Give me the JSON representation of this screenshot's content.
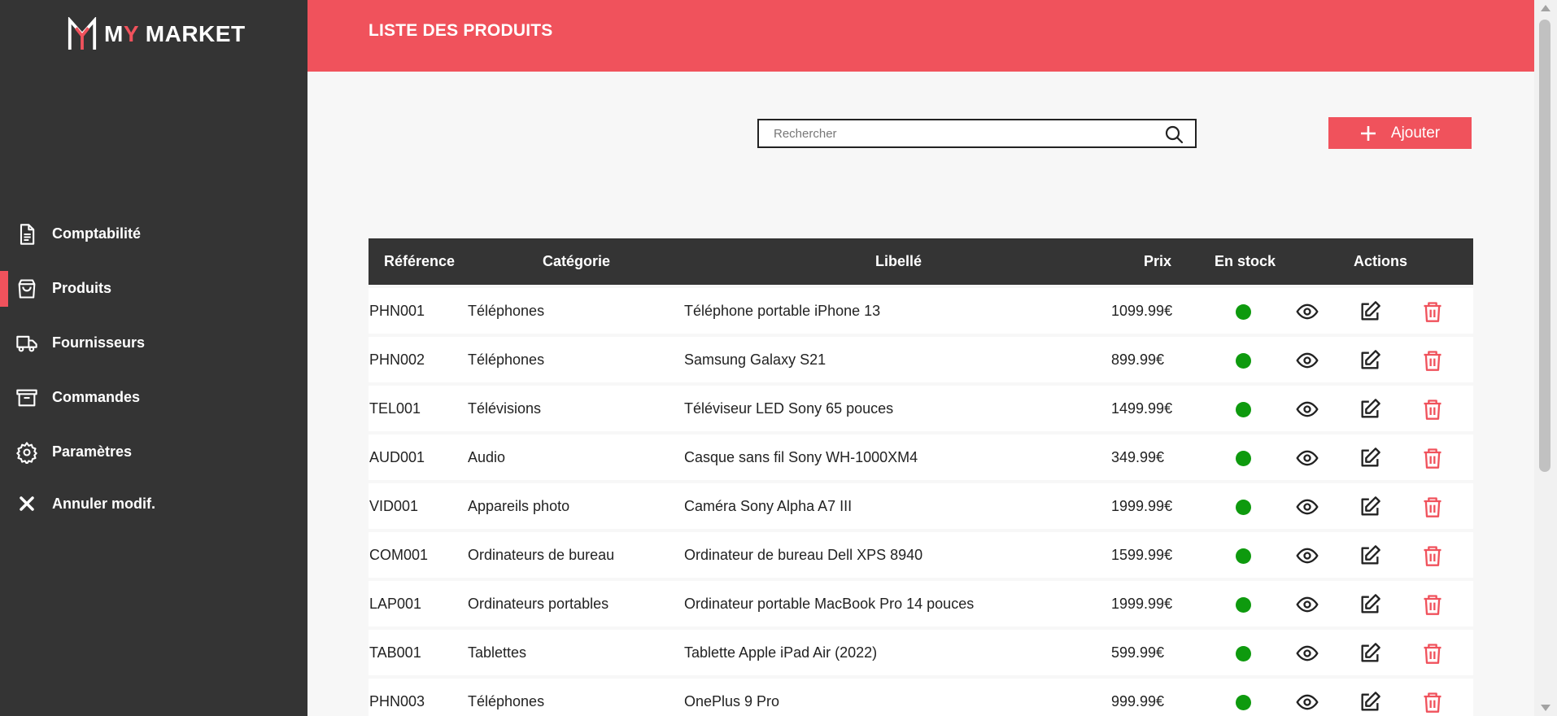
{
  "brand": {
    "prefix_m": "M",
    "accent_y": "Y",
    "rest": " MARKET",
    "accent_color": "#f0525c"
  },
  "sidebar": {
    "items": [
      {
        "label": "Comptabilité",
        "icon": "document-icon",
        "active": false
      },
      {
        "label": "Produits",
        "icon": "shopping-bag-icon",
        "active": true
      },
      {
        "label": "Fournisseurs",
        "icon": "truck-icon",
        "active": false
      },
      {
        "label": "Commandes",
        "icon": "archive-box-icon",
        "active": false
      },
      {
        "label": "Paramètres",
        "icon": "gear-icon",
        "active": false
      },
      {
        "label": "Annuler modif.",
        "icon": "close-icon",
        "active": false
      }
    ]
  },
  "header": {
    "title": "LISTE DES PRODUITS"
  },
  "search": {
    "placeholder": "Rechercher",
    "value": ""
  },
  "toolbar": {
    "add_label": "Ajouter"
  },
  "table": {
    "headers": {
      "ref": "Référence",
      "cat": "Catégorie",
      "lib": "Libellé",
      "prix": "Prix",
      "stock": "En stock",
      "actions": "Actions"
    },
    "rows": [
      {
        "ref": "PHN001",
        "cat": "Téléphones",
        "lib": "Téléphone portable iPhone 13",
        "prix": "1099.99€",
        "in_stock": true
      },
      {
        "ref": "PHN002",
        "cat": "Téléphones",
        "lib": "Samsung Galaxy S21",
        "prix": "899.99€",
        "in_stock": true
      },
      {
        "ref": "TEL001",
        "cat": "Télévisions",
        "lib": "Téléviseur LED Sony 65 pouces",
        "prix": "1499.99€",
        "in_stock": true
      },
      {
        "ref": "AUD001",
        "cat": "Audio",
        "lib": "Casque sans fil Sony WH-1000XM4",
        "prix": "349.99€",
        "in_stock": true
      },
      {
        "ref": "VID001",
        "cat": "Appareils photo",
        "lib": "Caméra Sony Alpha A7 III",
        "prix": "1999.99€",
        "in_stock": true
      },
      {
        "ref": "COM001",
        "cat": "Ordinateurs de bureau",
        "lib": "Ordinateur de bureau Dell XPS 8940",
        "prix": "1599.99€",
        "in_stock": true
      },
      {
        "ref": "LAP001",
        "cat": "Ordinateurs portables",
        "lib": "Ordinateur portable MacBook Pro 14 pouces",
        "prix": "1999.99€",
        "in_stock": true
      },
      {
        "ref": "TAB001",
        "cat": "Tablettes",
        "lib": "Tablette Apple iPad Air (2022)",
        "prix": "599.99€",
        "in_stock": true
      },
      {
        "ref": "PHN003",
        "cat": "Téléphones",
        "lib": "OnePlus 9 Pro",
        "prix": "999.99€",
        "in_stock": true
      }
    ]
  },
  "colors": {
    "accent": "#f0525c",
    "sidebar_bg": "#343434",
    "in_stock": "#0e9a0e",
    "delete_icon": "#f0525c"
  }
}
